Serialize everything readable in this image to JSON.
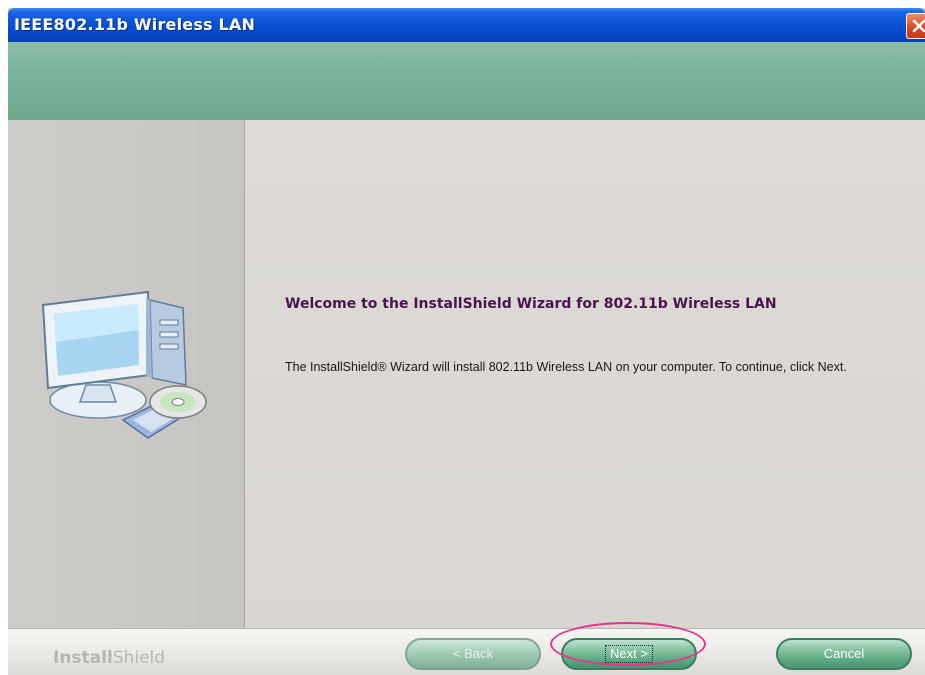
{
  "window": {
    "title": "IEEE802.11b Wireless LAN"
  },
  "content": {
    "heading": "Welcome to the InstallShield Wizard for 802.11b Wireless LAN",
    "body": "The InstallShield® Wizard will install 802.11b Wireless LAN on your computer.  To continue, click Next."
  },
  "footer": {
    "brand_bold": "Install",
    "brand_thin": "Shield",
    "back_label": "< Back",
    "next_label": "Next >",
    "cancel_label": "Cancel"
  },
  "colors": {
    "title_bar": "#0a52d6",
    "banner": "#7ab39b",
    "heading_text": "#4b1450",
    "button": "#5da983",
    "highlight": "#e8338b"
  }
}
